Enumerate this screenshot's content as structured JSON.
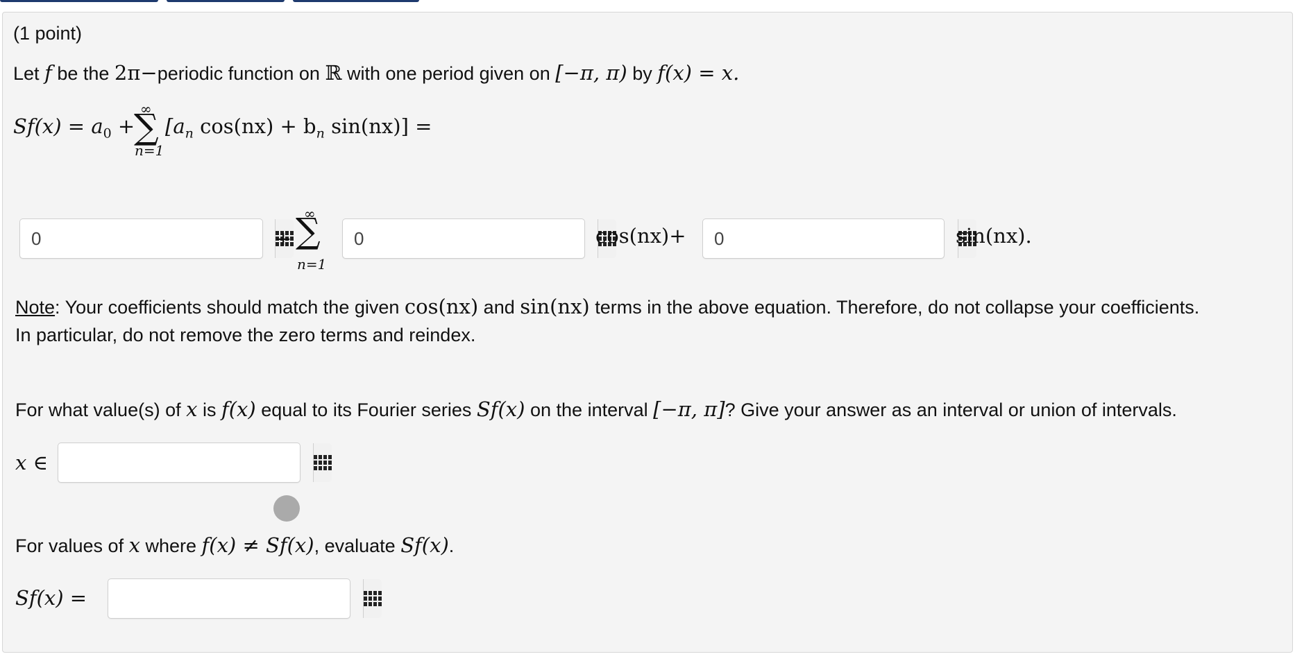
{
  "problem": {
    "points": "(1 point)",
    "intro": {
      "let": "Let",
      "f": "f",
      "be_the": "be the",
      "two_pi": "2π−",
      "periodic": "periodic function on",
      "reals": "ℝ",
      "with_one_period": "with one period given on",
      "interval": "[−π, π)",
      "by": "by",
      "definition": "f(x) = x."
    },
    "series_definition": {
      "lhs": "Sf(x) = a",
      "lhs_sub": "0",
      "plus": " +",
      "sum_symbol": "∑",
      "sum_upper": "∞",
      "sum_lower": "n=1",
      "body_1": "[a",
      "sub_n1": "n",
      "cos_part": " cos(nx) + b",
      "sub_n2": "n",
      "sin_part": " sin(nx)] ="
    },
    "answer_row": {
      "a0_value": "0",
      "plus_sum": "+",
      "sum_symbol": "∑",
      "sum_upper": "∞",
      "sum_lower": "n=1",
      "an_value": "0",
      "cos_label": "cos(nx)+",
      "bn_value": "0",
      "sin_label": "sin(nx)."
    },
    "note": {
      "label": "Note",
      "colon": ":",
      "text_1": "Your coefficients should match the given",
      "cos": "cos(nx)",
      "and": "and",
      "sin": "sin(nx)",
      "text_2": "terms in the above equation. Therefore, do not collapse your coefficients.",
      "line_2": "In particular, do not remove the zero terms and reindex."
    },
    "question_2": {
      "text_1": "For what value(s) of",
      "x": "x",
      "is": "is",
      "fx": "f(x)",
      "equal_to": "equal to its Fourier series",
      "sfx": "Sf(x)",
      "on_interval": "on the interval",
      "interval": "[−π, π]",
      "text_2": "? Give your answer as an interval or union of intervals.",
      "label": "x ∈",
      "value": ""
    },
    "question_3": {
      "text_1": "For values of",
      "x": "x",
      "where": "where",
      "expr": "f(x) ≠ Sf(x)",
      "text_2": ", evaluate",
      "sfx": "Sf(x)",
      "period": ".",
      "label": "Sf(x) =",
      "value": ""
    }
  },
  "icons": {
    "keypad": "keypad-grid-icon",
    "spinner": "loading-spinner-icon"
  },
  "colors": {
    "panel_bg": "#f4f4f4",
    "tab_accent": "#1e3a6e"
  }
}
